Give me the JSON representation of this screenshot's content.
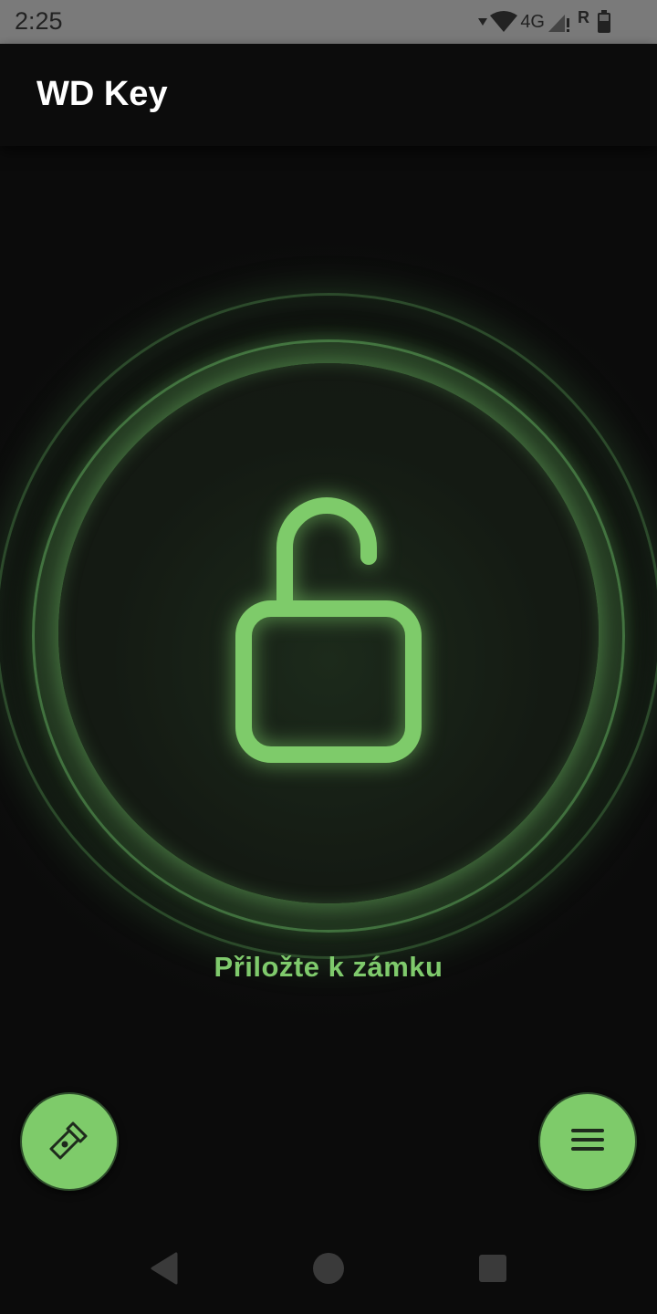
{
  "status_bar": {
    "time": "2:25",
    "network": "4G",
    "roaming": "R",
    "icons": [
      "download-indicator-icon",
      "wifi-icon",
      "signal-icon",
      "battery-icon"
    ]
  },
  "app_bar": {
    "title": "WD Key"
  },
  "lock": {
    "state": "unlocked",
    "icon": "lock-open-icon",
    "status_text": "Přiložte k zámku",
    "accent_color": "#7ecb6a"
  },
  "actions": {
    "left_icon": "flashlight-icon",
    "right_icon": "menu-icon"
  },
  "nav_bar": {
    "icons": [
      "back-icon",
      "home-icon",
      "recents-icon"
    ]
  }
}
